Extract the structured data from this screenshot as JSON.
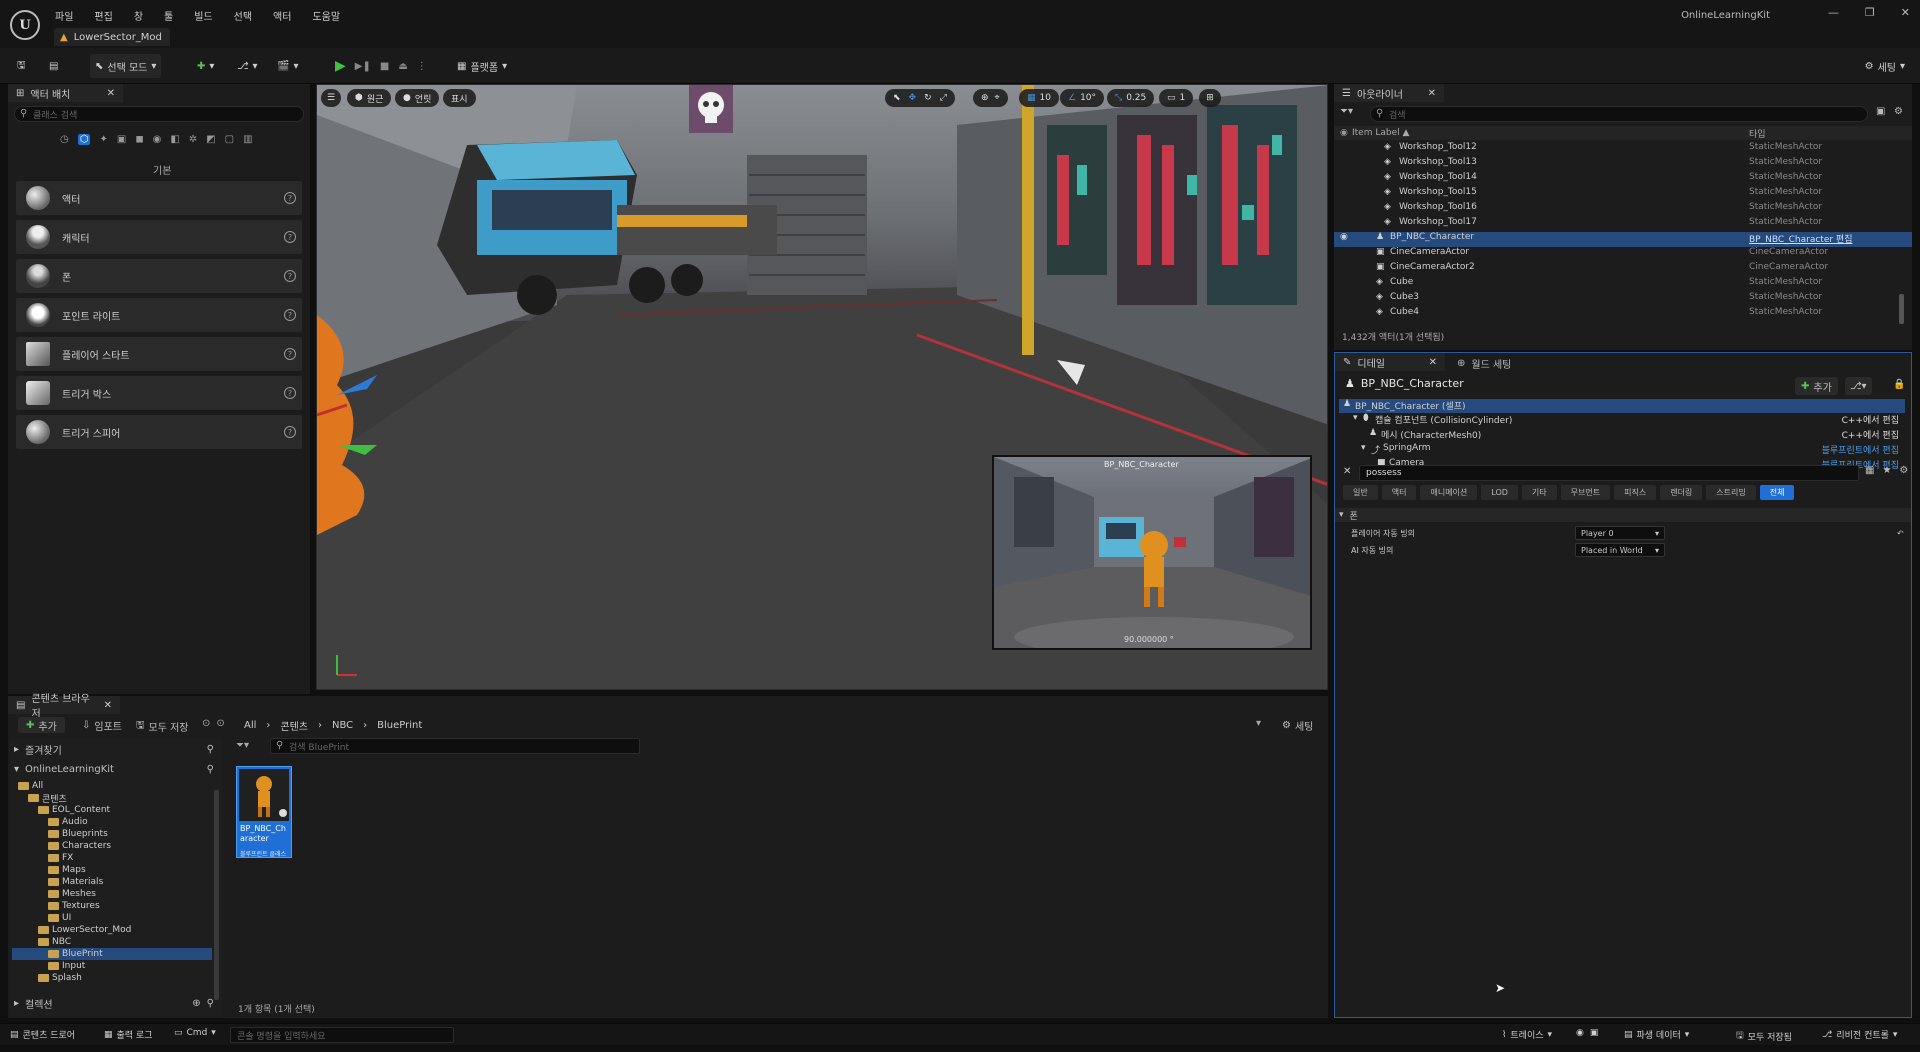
{
  "window": {
    "menu": [
      "파일",
      "편집",
      "창",
      "툴",
      "빌드",
      "선택",
      "액터",
      "도움말"
    ],
    "level_tab": "LowerSector_Mod",
    "project_name": "OnlineLearningKit"
  },
  "toolbar": {
    "mode": "선택 모드",
    "platforms": "플랫폼",
    "settings": "세팅"
  },
  "place_actors": {
    "tab": "액터 배치",
    "search_placeholder": "클래스 검색",
    "section": "기본",
    "items": [
      "액터",
      "캐릭터",
      "폰",
      "포인트 라이트",
      "플레이어 스타트",
      "트리거 박스",
      "트리거 스피어"
    ]
  },
  "viewport": {
    "view_mode": "원근",
    "lit": "언릿",
    "show": "표시",
    "grid_snap": "10",
    "rot_snap": "10°",
    "scale_snap": "0.25",
    "camera_speed": "1",
    "pip_label": "BP_NBC_Character",
    "pip_value": "90.000000 °"
  },
  "outliner": {
    "tab": "아웃라이너",
    "search_placeholder": "검색",
    "col_label": "Item Label ▲",
    "col_type": "타입",
    "rows": [
      {
        "name": "Workshop_Tool12",
        "type": "StaticMeshActor"
      },
      {
        "name": "Workshop_Tool13",
        "type": "StaticMeshActor"
      },
      {
        "name": "Workshop_Tool14",
        "type": "StaticMeshActor"
      },
      {
        "name": "Workshop_Tool15",
        "type": "StaticMeshActor"
      },
      {
        "name": "Workshop_Tool16",
        "type": "StaticMeshActor"
      },
      {
        "name": "Workshop_Tool17",
        "type": "StaticMeshActor"
      },
      {
        "name": "BP_NBC_Character",
        "type": "BP_NBC_Character 편집"
      },
      {
        "name": "CineCameraActor",
        "type": "CineCameraActor"
      },
      {
        "name": "CineCameraActor2",
        "type": "CineCameraActor"
      },
      {
        "name": "Cube",
        "type": "StaticMeshActor"
      },
      {
        "name": "Cube3",
        "type": "StaticMeshActor"
      },
      {
        "name": "Cube4",
        "type": "StaticMeshActor"
      }
    ],
    "count": "1,432개 액터(1개 선택됨)"
  },
  "details": {
    "tab": "디테일",
    "tab2": "월드 세팅",
    "actor_name": "BP_NBC_Character",
    "add_label": "추가",
    "components": [
      {
        "name": "BP_NBC_Character (셀프)",
        "edit": ""
      },
      {
        "name": "캡슐 컴포넌트 (CollisionCylinder)",
        "edit": "C++에서 편집"
      },
      {
        "name": "메시 (CharacterMesh0)",
        "edit": "C++에서 편집"
      },
      {
        "name": "SpringArm",
        "edit": "블루프린트에서 편집"
      },
      {
        "name": "Camera",
        "edit": "블루프린트에서 편집"
      }
    ],
    "filter_text": "possess",
    "categories": [
      "일반",
      "액터",
      "애니메이션",
      "LOD",
      "기타",
      "무브먼트",
      "피직스",
      "렌더링",
      "스트리밍",
      "전체"
    ],
    "section": "폰",
    "props": [
      {
        "label": "플레이어 자동 빙의",
        "value": "Player 0"
      },
      {
        "label": "AI 자동 빙의",
        "value": "Placed in World"
      }
    ]
  },
  "content_browser": {
    "tab": "콘텐츠 브라우저",
    "add": "추가",
    "import": "임포트",
    "save_all": "모두 저장",
    "path": [
      "All",
      "콘텐츠",
      "NBC",
      "BluePrint"
    ],
    "settings": "세팅",
    "favorites": "즐겨찾기",
    "project": "OnlineLearningKit",
    "search_placeholder": "검색 BluePrint",
    "tree": [
      {
        "label": "All",
        "indent": 0
      },
      {
        "label": "콘텐츠",
        "indent": 1
      },
      {
        "label": "EOL_Content",
        "indent": 2
      },
      {
        "label": "Audio",
        "indent": 3
      },
      {
        "label": "Blueprints",
        "indent": 3
      },
      {
        "label": "Characters",
        "indent": 3
      },
      {
        "label": "FX",
        "indent": 3
      },
      {
        "label": "Maps",
        "indent": 3
      },
      {
        "label": "Materials",
        "indent": 3
      },
      {
        "label": "Meshes",
        "indent": 3
      },
      {
        "label": "Textures",
        "indent": 3
      },
      {
        "label": "UI",
        "indent": 3
      },
      {
        "label": "LowerSector_Mod",
        "indent": 2
      },
      {
        "label": "NBC",
        "indent": 2
      },
      {
        "label": "BluePrint",
        "indent": 3
      },
      {
        "label": "Input",
        "indent": 3
      },
      {
        "label": "Splash",
        "indent": 2
      }
    ],
    "collections": "컬렉션",
    "asset_name": "BP_NBC_Character",
    "asset_type": "블루프린트 클래스",
    "item_count": "1개 항목 (1개 선택)"
  },
  "statusbar": {
    "content_drawer": "콘텐츠 드로어",
    "output_log": "출력 로그",
    "cmd": "Cmd",
    "console_placeholder": "콘솔 명령을 입력하세요",
    "trace": "트레이스",
    "derived_data": "파생 데이터",
    "save_all": "모두 저장됨",
    "source_control": "리비전 컨트롤"
  }
}
